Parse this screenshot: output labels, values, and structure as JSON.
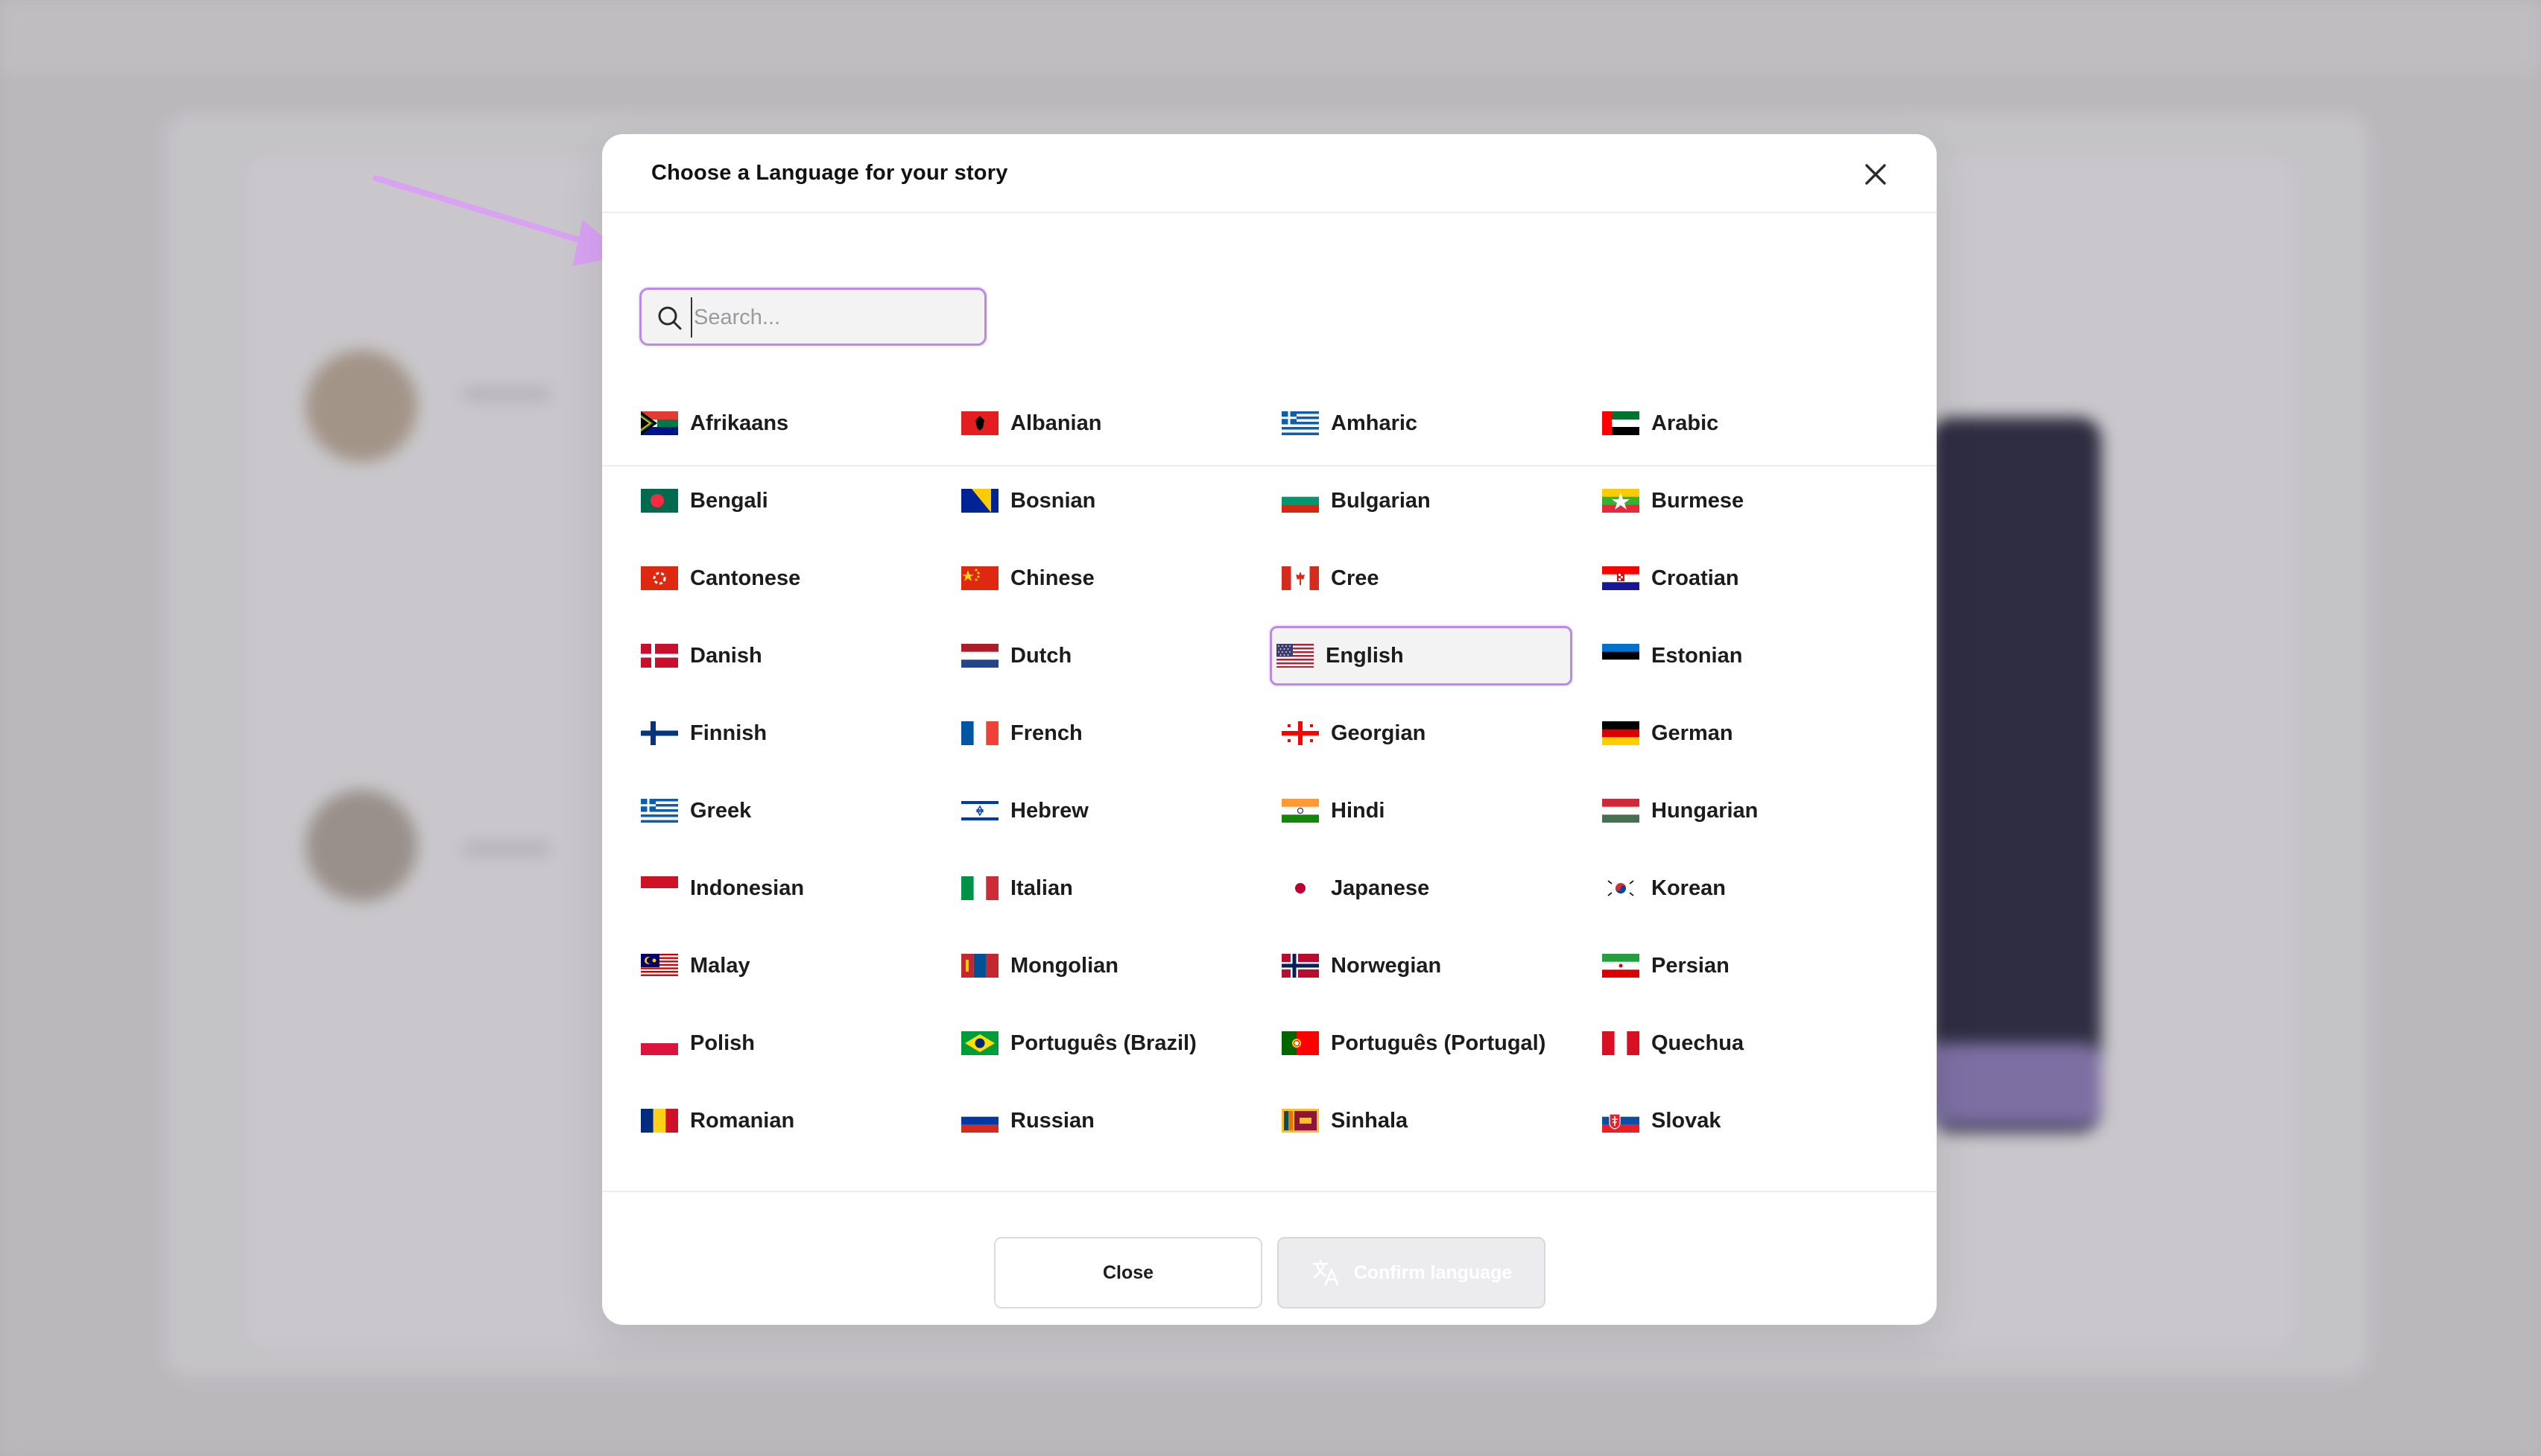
{
  "modal": {
    "title": "Choose a Language for your story",
    "search": {
      "placeholder": "Search...",
      "value": ""
    },
    "selected_language": "English",
    "languages": [
      {
        "name": "Afrikaans",
        "flag": "south-africa"
      },
      {
        "name": "Albanian",
        "flag": "albania"
      },
      {
        "name": "Amharic",
        "flag": "greece-like"
      },
      {
        "name": "Arabic",
        "flag": "uae"
      },
      {
        "name": "Bengali",
        "flag": "bangladesh"
      },
      {
        "name": "Bosnian",
        "flag": "bosnia"
      },
      {
        "name": "Bulgarian",
        "flag": "bulgaria"
      },
      {
        "name": "Burmese",
        "flag": "myanmar"
      },
      {
        "name": "Cantonese",
        "flag": "hong-kong"
      },
      {
        "name": "Chinese",
        "flag": "china"
      },
      {
        "name": "Cree",
        "flag": "canada"
      },
      {
        "name": "Croatian",
        "flag": "croatia"
      },
      {
        "name": "Danish",
        "flag": "denmark"
      },
      {
        "name": "Dutch",
        "flag": "netherlands"
      },
      {
        "name": "English",
        "flag": "usa"
      },
      {
        "name": "Estonian",
        "flag": "estonia"
      },
      {
        "name": "Finnish",
        "flag": "finland"
      },
      {
        "name": "French",
        "flag": "france"
      },
      {
        "name": "Georgian",
        "flag": "georgia"
      },
      {
        "name": "German",
        "flag": "germany"
      },
      {
        "name": "Greek",
        "flag": "greece"
      },
      {
        "name": "Hebrew",
        "flag": "israel"
      },
      {
        "name": "Hindi",
        "flag": "india"
      },
      {
        "name": "Hungarian",
        "flag": "hungary"
      },
      {
        "name": "Indonesian",
        "flag": "indonesia"
      },
      {
        "name": "Italian",
        "flag": "italy"
      },
      {
        "name": "Japanese",
        "flag": "japan"
      },
      {
        "name": "Korean",
        "flag": "south-korea"
      },
      {
        "name": "Malay",
        "flag": "malaysia"
      },
      {
        "name": "Mongolian",
        "flag": "mongolia"
      },
      {
        "name": "Norwegian",
        "flag": "norway"
      },
      {
        "name": "Persian",
        "flag": "iran"
      },
      {
        "name": "Polish",
        "flag": "poland"
      },
      {
        "name": "Português (Brazil)",
        "flag": "brazil"
      },
      {
        "name": "Português (Portugal)",
        "flag": "portugal"
      },
      {
        "name": "Quechua",
        "flag": "peru"
      },
      {
        "name": "Romanian",
        "flag": "romania"
      },
      {
        "name": "Russian",
        "flag": "russia"
      },
      {
        "name": "Sinhala",
        "flag": "sri-lanka"
      },
      {
        "name": "Slovak",
        "flag": "slovakia"
      }
    ],
    "footer": {
      "close_label": "Close",
      "confirm_label": "Confirm language",
      "confirm_icon": "translate-icon"
    }
  },
  "colors": {
    "accent": "#b98be6",
    "annotation_arrow": "#d9a2f2",
    "text": "#1c1c1f"
  }
}
